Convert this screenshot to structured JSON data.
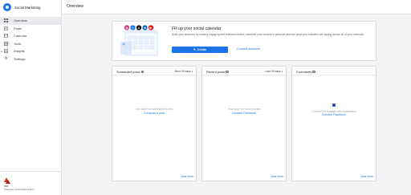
{
  "app": {
    "name": "Social Marketing"
  },
  "sidebar": {
    "items": [
      {
        "label": "Overview",
        "icon": "grid-icon"
      },
      {
        "label": "Posts",
        "icon": "document-icon"
      },
      {
        "label": "Calendar",
        "icon": "calendar-icon"
      },
      {
        "label": "Tools",
        "icon": "tools-icon"
      },
      {
        "label": "Insights",
        "icon": "chart-icon"
      },
      {
        "label": "Settings",
        "icon": "gear-icon"
      }
    ],
    "footer": {
      "brand": "RDO",
      "powered": "Powered by Social Media Solutions"
    }
  },
  "header": {
    "title": "Overview"
  },
  "promo": {
    "title": "Fill up your social calendar",
    "description": "Build your audience by sharing engaging and relevant content, schedule your content in advance and see what your followers are saying across all of your networks.",
    "create_label": "Create",
    "connect_label": "Connect accounts",
    "networks": [
      {
        "name": "instagram",
        "color": "#c13584",
        "glyph": "◎"
      },
      {
        "name": "facebook",
        "color": "#1877f2",
        "glyph": "f"
      },
      {
        "name": "x",
        "color": "#000000",
        "glyph": "X"
      },
      {
        "name": "linkedin",
        "color": "#0a66c2",
        "glyph": "in"
      },
      {
        "name": "youtube",
        "color": "#ff0000",
        "glyph": "▶"
      }
    ]
  },
  "cards": [
    {
      "title": "Scheduled posts",
      "range": "Next 30 days",
      "empty_text": "You have no scheduled posts",
      "link": "Compose a post",
      "view_more": "View more"
    },
    {
      "title": "Recent posts",
      "range": "Last 30 days",
      "empty_text": "You have no recent posts",
      "link": "Connect Facebook",
      "view_more": "View more"
    },
    {
      "title": "Comments",
      "range": "",
      "empty_text": "Connect to engage with customers",
      "link": "Connect Facebook",
      "view_more": "View more"
    }
  ],
  "colors": {
    "accent": "#1a73e8",
    "sidebar_active": "#e8eaed",
    "background": "#f1f3f4"
  }
}
